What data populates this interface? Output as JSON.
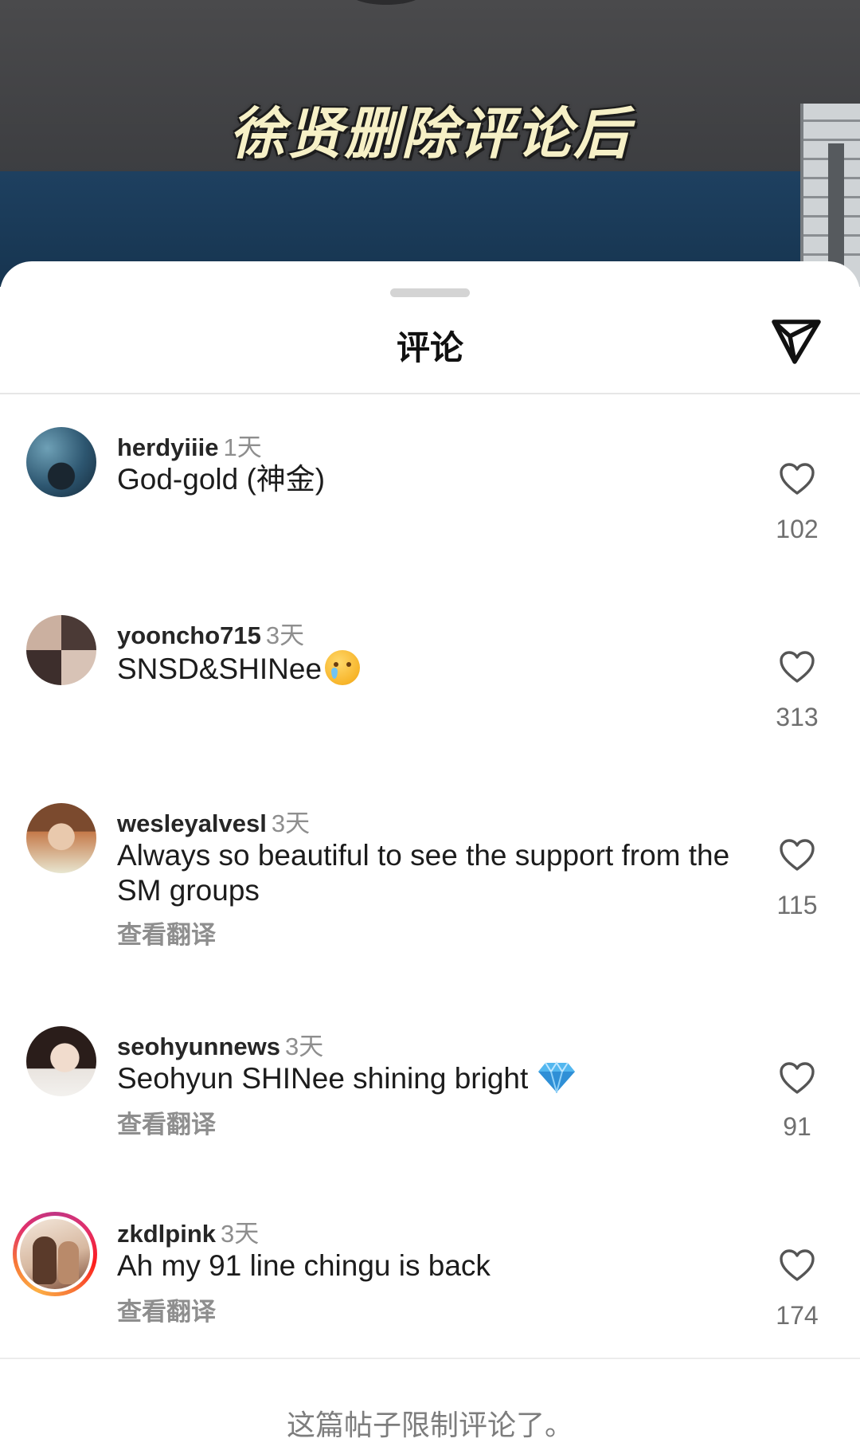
{
  "video": {
    "overlay_title": "徐贤删除评论后"
  },
  "sheet": {
    "title": "评论",
    "share_icon": "send-icon"
  },
  "comments": [
    {
      "username": "herdyiiie",
      "time": "1天",
      "text": "God-gold (神金)",
      "emoji": "",
      "translate_label": "",
      "likes": "102"
    },
    {
      "username": "yooncho715",
      "time": "3天",
      "text": "SNSD&SHINee",
      "emoji": "crying-face-emoji",
      "translate_label": "",
      "likes": "313"
    },
    {
      "username": "wesleyalvesl",
      "time": "3天",
      "text": "Always so beautiful to see the support from the SM groups",
      "emoji": "",
      "translate_label": "查看翻译",
      "likes": "115"
    },
    {
      "username": "seohyunnews",
      "time": "3天",
      "text": "Seohyun SHINee shining bright",
      "emoji": "gem-emoji",
      "translate_label": "查看翻译",
      "likes": "91"
    },
    {
      "username": "zkdlpink",
      "time": "3天",
      "text": "Ah my 91 line chingu is back",
      "emoji": "",
      "translate_label": "查看翻译",
      "likes": "174"
    }
  ],
  "footer": {
    "restricted_notice": "这篇帖子限制评论了。"
  },
  "colors": {
    "username": "#262626",
    "muted": "#8e8e8e",
    "text": "#1c1c1c",
    "divider": "#e6e6e6",
    "story_ring": "#e1306c"
  }
}
